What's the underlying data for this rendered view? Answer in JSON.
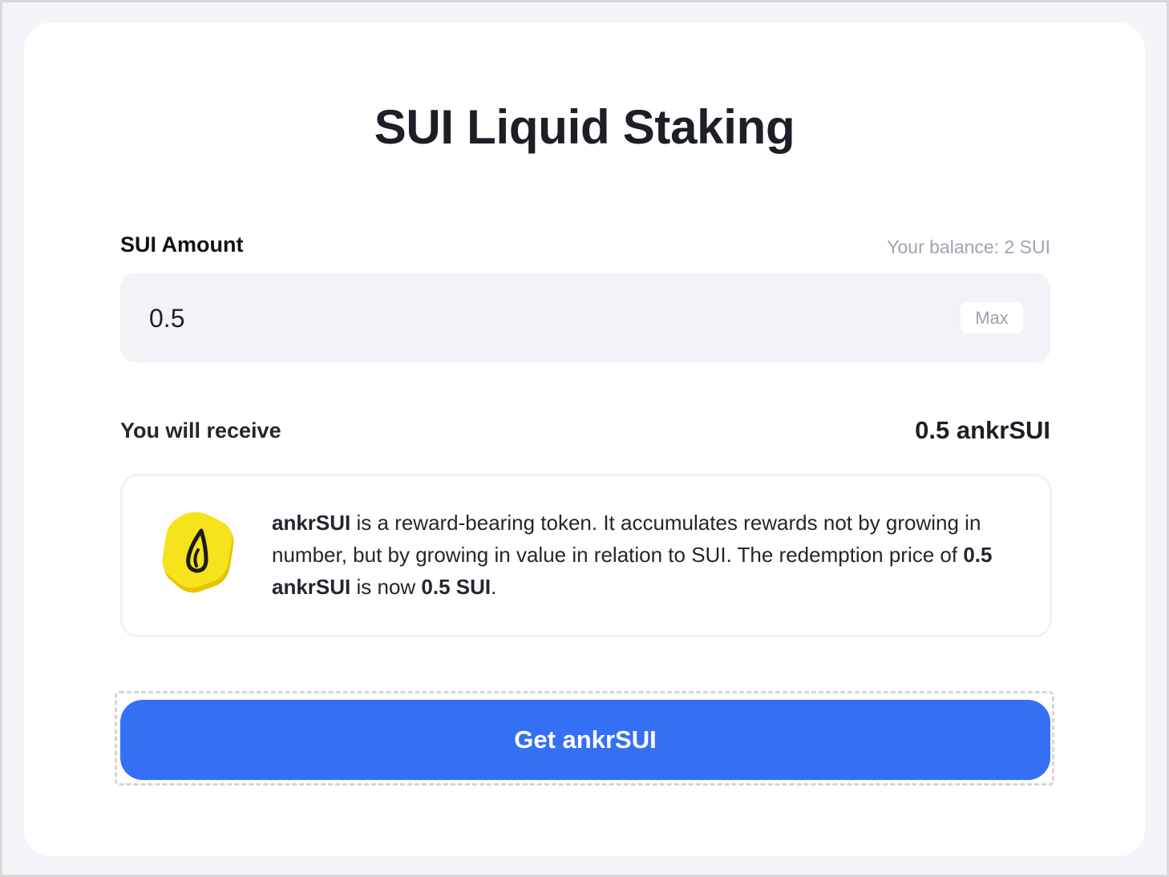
{
  "page": {
    "title": "SUI Liquid Staking"
  },
  "amount": {
    "label": "SUI Amount",
    "balance_text": "Your balance: 2 SUI",
    "value": "0.5",
    "max_label": "Max"
  },
  "receive": {
    "label": "You will receive",
    "value": "0.5 ankrSUI"
  },
  "info": {
    "token_name": "ankrSUI",
    "text_part1": " is a reward-bearing token. It accumulates rewards not by growing in number, but by growing in value in relation to SUI. The redemption price of ",
    "amount": "0.5 ankrSUI",
    "text_part2": " is now ",
    "price": "0.5 SUI",
    "text_part3": ".",
    "icon": "ankrsui-token-icon"
  },
  "cta": {
    "label": "Get ankrSUI"
  },
  "colors": {
    "accent": "#356ff3",
    "background": "#f4f5f9",
    "token_yellow": "#f7e31c"
  }
}
